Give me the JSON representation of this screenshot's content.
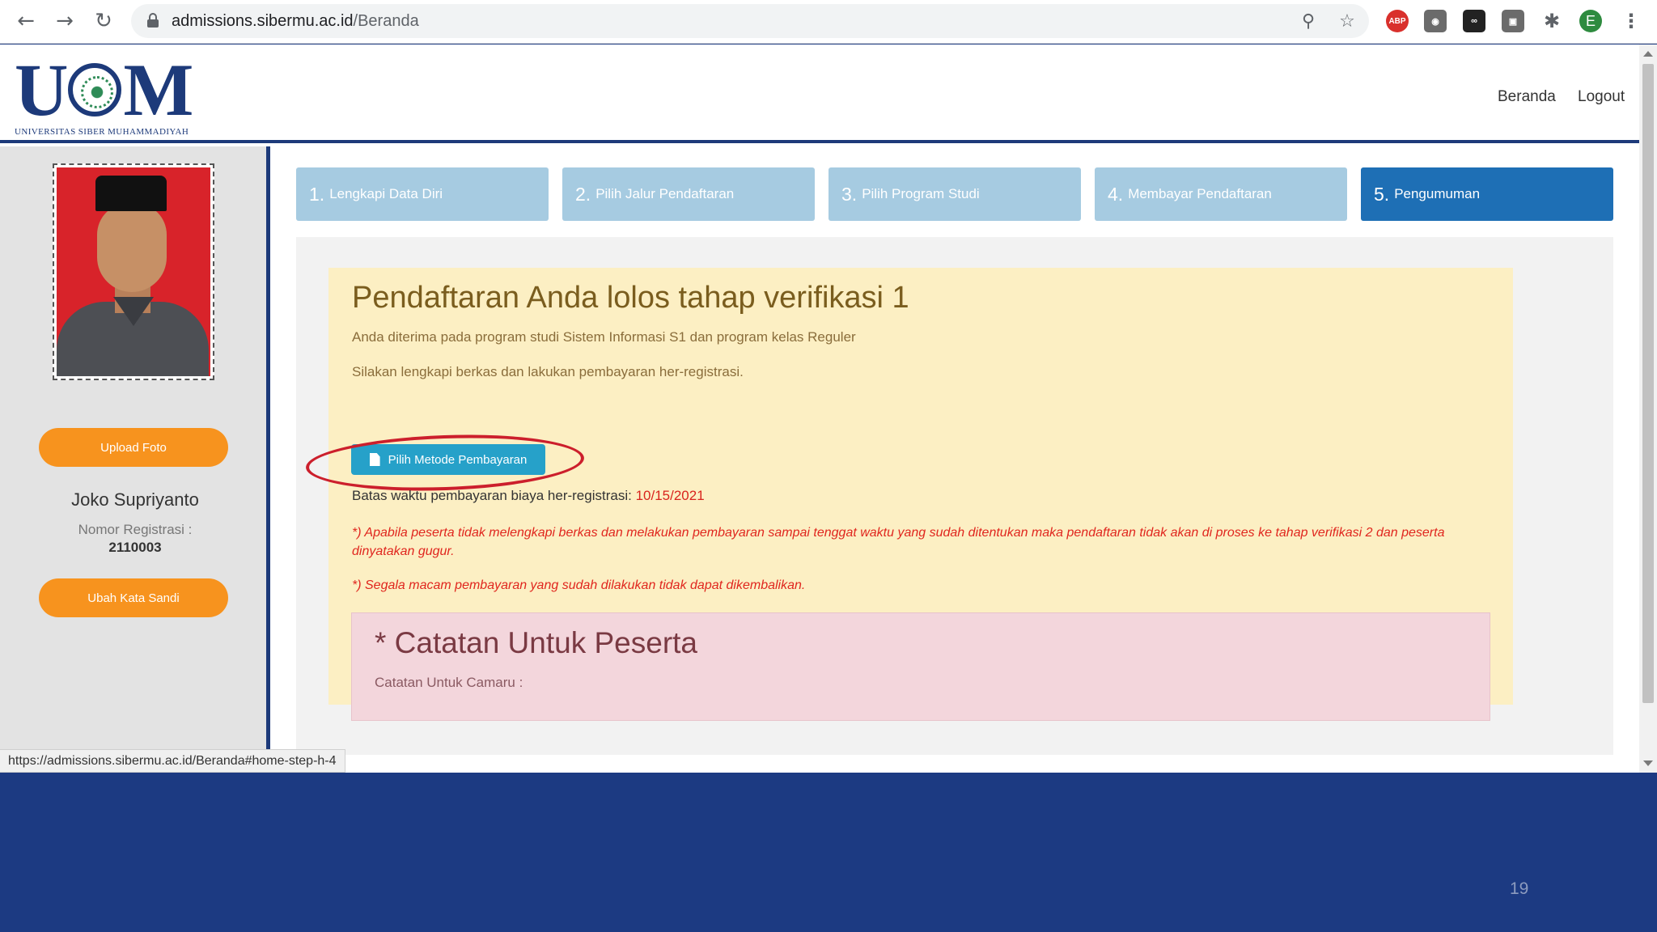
{
  "browser": {
    "url_domain": "admissions.sibermu.ac.id",
    "url_path": "/Beranda",
    "back_icon": "arrow-left",
    "forward_icon": "arrow-right",
    "reload_icon": "reload",
    "extensions": {
      "abp": "ABP",
      "profile_initial": "E"
    },
    "status_url": "https://admissions.sibermu.ac.id/Beranda#home-step-h-4"
  },
  "header": {
    "logo_text": "UCM",
    "logo_subtitle": "UNIVERSITAS SIBER MUHAMMADIYAH",
    "nav": [
      {
        "label": "Beranda"
      },
      {
        "label": "Logout"
      }
    ]
  },
  "sidebar": {
    "upload_label": "Upload Foto",
    "user_name": "Joko Supriyanto",
    "reg_label": "Nomor Registrasi :",
    "reg_number": "2110003",
    "password_label": "Ubah Kata Sandi"
  },
  "steps": [
    {
      "num": "1.",
      "label": "Lengkapi Data Diri",
      "active": false
    },
    {
      "num": "2.",
      "label": "Pilih Jalur Pendaftaran",
      "active": false
    },
    {
      "num": "3.",
      "label": "Pilih Program Studi",
      "active": false
    },
    {
      "num": "4.",
      "label": "Membayar Pendaftaran",
      "active": false
    },
    {
      "num": "5.",
      "label": "Pengumuman",
      "active": true
    }
  ],
  "announcement": {
    "headline": "Pendaftaran Anda lolos tahap verifikasi 1",
    "accepted_text": "Anda diterima pada program studi Sistem Informasi S1 dan program kelas Reguler",
    "instruction": "Silakan lengkapi berkas dan lakukan pembayaran her-registrasi.",
    "pay_button": "Pilih Metode Pembayaran",
    "deadline_label": "Batas waktu pembayaran biaya her-registrasi:",
    "deadline_date": "10/15/2021",
    "warning_1": "*) Apabila peserta tidak melengkapi berkas dan melakukan pembayaran sampai tenggat waktu yang sudah ditentukan maka pendaftaran tidak akan di proses ke tahap verifikasi 2 dan peserta dinyatakan gugur.",
    "warning_2": "*) Segala macam pembayaran yang sudah dilakukan tidak dapat dikembalikan."
  },
  "catatan": {
    "title": "* Catatan Untuk Peserta",
    "text": "Catatan Untuk Camaru :"
  },
  "slide_number": "19",
  "colors": {
    "brand_navy": "#1d3a7a",
    "slide_background": "#1c3a82",
    "step_inactive": "#a6cbe1",
    "step_active": "#1e6fb5",
    "orange_button": "#f7931e",
    "pay_button": "#26a1c9",
    "warning_red": "#e0261e",
    "annotation_circle": "#cc1f2c"
  }
}
